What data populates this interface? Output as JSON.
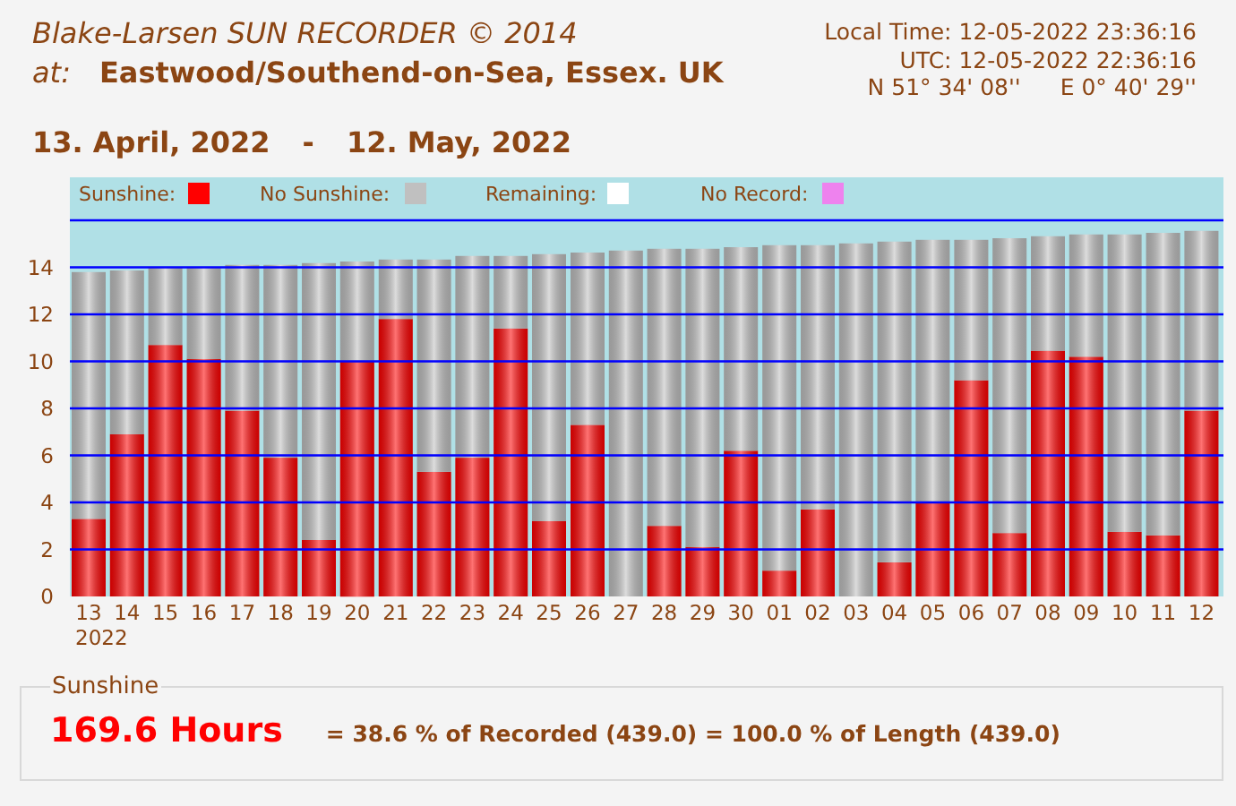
{
  "header": {
    "title": "Blake-Larsen SUN RECORDER © 2014",
    "location_label": "at:",
    "location": "Eastwood/Southend-on-Sea, Essex. UK",
    "local_time": "Local Time: 12-05-2022 23:36:16",
    "utc_time": "UTC: 12-05-2022 22:36:16",
    "latitude": "N 51° 34' 08''",
    "longitude": "E 0° 40' 29''"
  },
  "period": {
    "start": "13. April, 2022",
    "separator": "-",
    "end": "12. May, 2022"
  },
  "legend": [
    {
      "label": "Remaining:",
      "color": "#ffffff"
    },
    {
      "label": "No Record:",
      "color": "#ee82ee"
    }
  ],
  "year_label": "2022",
  "chart_data": {
    "type": "bar",
    "stacked": true,
    "categories": [
      "13",
      "14",
      "15",
      "16",
      "17",
      "18",
      "19",
      "20",
      "21",
      "22",
      "23",
      "24",
      "25",
      "26",
      "27",
      "28",
      "29",
      "30",
      "01",
      "02",
      "03",
      "04",
      "05",
      "06",
      "07",
      "08",
      "09",
      "10",
      "11",
      "12"
    ],
    "grid": true,
    "legend": "top",
    "series": [
      {
        "name": "Sunshine:",
        "color": "#ff0000",
        "values": [
          3.3,
          6.9,
          10.7,
          10.1,
          7.9,
          5.9,
          2.4,
          10.0,
          11.8,
          5.3,
          5.9,
          11.4,
          3.2,
          7.3,
          0,
          3.0,
          2.1,
          6.2,
          1.1,
          3.7,
          0,
          1.45,
          4.0,
          9.2,
          2.7,
          10.45,
          10.2,
          2.75,
          2.6,
          7.9
        ]
      },
      {
        "name": "No Sunshine:",
        "color": "#c0c0c0",
        "values": [
          10.5,
          6.97,
          3.3,
          3.9,
          6.2,
          8.2,
          11.78,
          4.25,
          2.53,
          9.03,
          8.58,
          3.08,
          11.36,
          7.33,
          14.71,
          11.79,
          12.69,
          8.66,
          13.84,
          11.24,
          15.02,
          13.64,
          11.17,
          5.97,
          12.54,
          4.87,
          5.2,
          12.65,
          12.87,
          7.65
        ]
      }
    ],
    "ylim": [
      0,
      16
    ],
    "yticks": [
      0,
      2,
      4,
      6,
      8,
      10,
      12,
      14
    ]
  },
  "summary": {
    "legend": "Sunshine",
    "hours": "169.6 Hours",
    "detail": "= 38.6 % of Recorded (439.0) = 100.0 % of Length (439.0)"
  }
}
